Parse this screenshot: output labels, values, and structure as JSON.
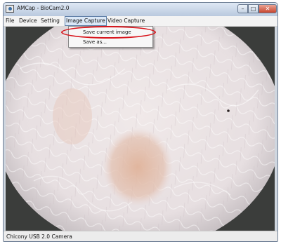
{
  "window": {
    "title": "AMCap - BioCam2.0",
    "min_glyph": "–",
    "max_glyph": "□",
    "close_glyph": "✕"
  },
  "menu": {
    "items": [
      "File",
      "Device",
      "Setting",
      "Image Capture",
      "Video Capture"
    ],
    "active_index": 3
  },
  "dropdown": {
    "items": [
      "Save current image",
      "Save as..."
    ]
  },
  "status": {
    "camera": "Chicony USB 2.0 Camera"
  },
  "colors": {
    "highlight_ring": "#d8141b",
    "skin_base": "#ece4e4",
    "lesion": "#e0b39a"
  }
}
